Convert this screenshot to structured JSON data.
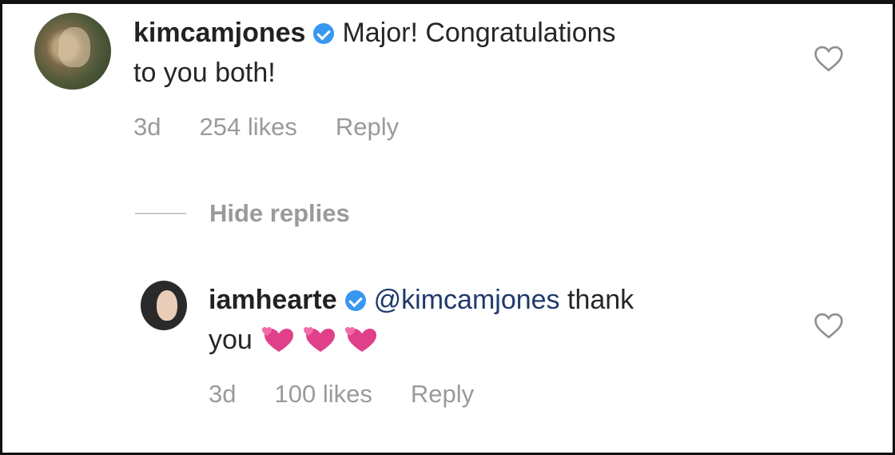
{
  "comments": [
    {
      "username": "kimcamjones",
      "text_line1": "Major! Congratulations",
      "text_line2": "to you both!",
      "age": "3d",
      "likes": "254 likes",
      "reply_label": "Reply"
    },
    {
      "username": "iamhearte",
      "mention": "@kimcamjones",
      "text_after_mention": " thank",
      "text_line2": "you",
      "emojis": [
        "revolving-hearts-icon",
        "revolving-hearts-icon",
        "revolving-hearts-icon"
      ],
      "age": "3d",
      "likes": "100 likes",
      "reply_label": "Reply"
    }
  ],
  "hide_replies_label": "Hide replies",
  "colors": {
    "text": "#262626",
    "meta": "#9a9a9a",
    "verified": "#3897f0",
    "mention": "#1f3a6b",
    "emoji": "#e0408a"
  }
}
